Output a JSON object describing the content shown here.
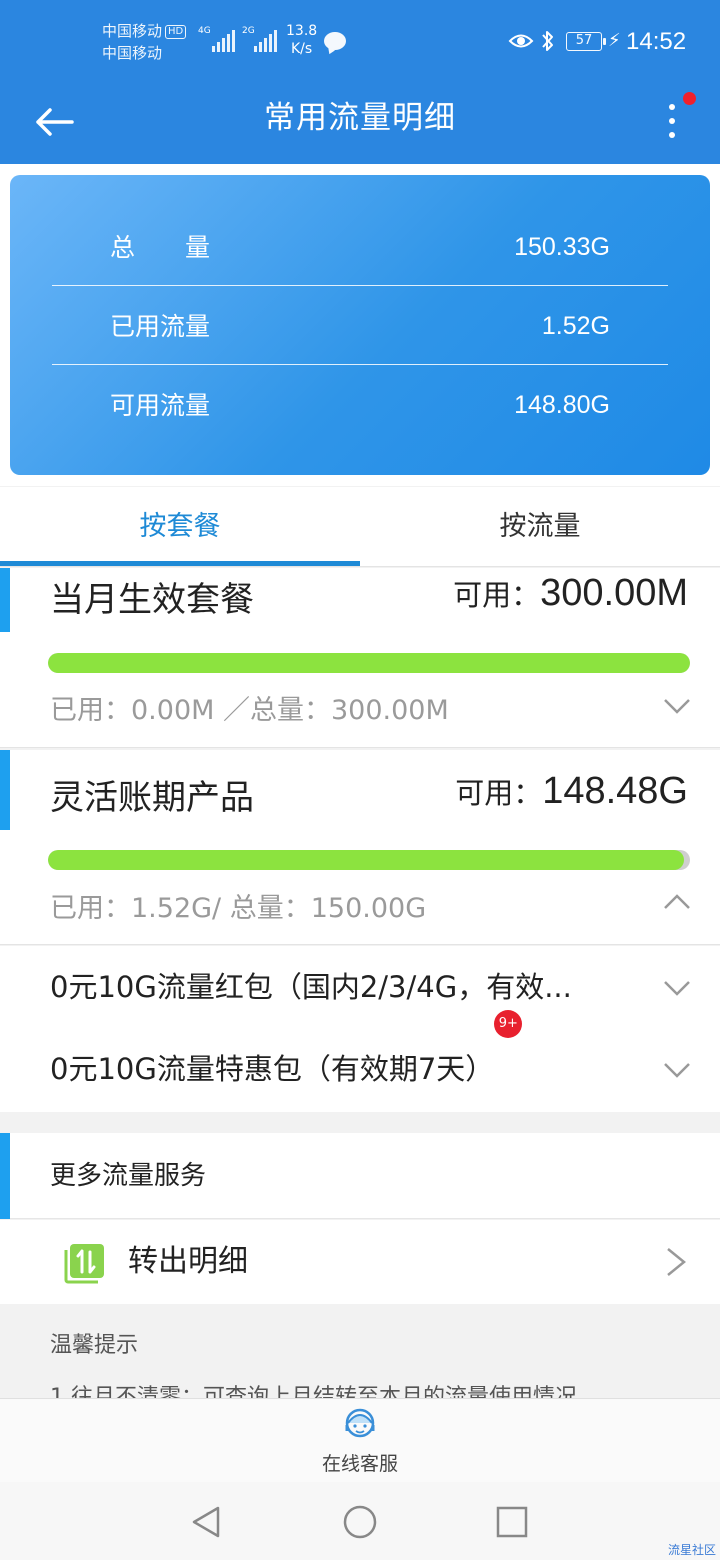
{
  "status_bar": {
    "carrier_1": "中国移动",
    "hd": "HD",
    "carrier_2": "中国移动",
    "sim1_network": "4G",
    "sim2_network": "2G",
    "net_speed_value": "13.8",
    "net_speed_unit": "K/s",
    "battery": "57",
    "time": "14:52"
  },
  "header": {
    "title": "常用流量明细"
  },
  "summary": {
    "total_label": "总　　量",
    "total_value": "150.33G",
    "used_label": "已用流量",
    "used_value": "1.52G",
    "available_label": "可用流量",
    "available_value": "148.80G"
  },
  "tabs": {
    "by_package": "按套餐",
    "by_flow": "按流量",
    "active": "by_package"
  },
  "packages": [
    {
      "name": "当月生效套餐",
      "available_label": "可用：",
      "available_value": "300.00M",
      "usage": "已用：0.00M ／总量：300.00M",
      "used_fraction": 0.0,
      "expanded": false
    },
    {
      "name": "灵活账期产品",
      "available_label": "可用：",
      "available_value": "148.48G",
      "usage": "已用：1.52G/ 总量：150.00G",
      "used_fraction": 0.0101,
      "expanded": true
    }
  ],
  "sub_items": [
    {
      "label": "0元10G流量红包（国内2/3/4G，有效...",
      "badge": ""
    },
    {
      "label": "0元10G流量特惠包（有效期7天）",
      "badge": "9+"
    }
  ],
  "services": {
    "heading": "更多流量服务",
    "transfer_label": "转出明细"
  },
  "tips": {
    "title": "温馨提示",
    "line_1": "1.往月不清零：可查询上月结转至本月的流量使用情况"
  },
  "bottom": {
    "online_service": "在线客服"
  },
  "watermark": "流星社区",
  "colors": {
    "header_bg": "#2b86e0",
    "accent": "#1e8ad6",
    "progress_fill": "#8ce33f",
    "badge": "#e8202e"
  }
}
